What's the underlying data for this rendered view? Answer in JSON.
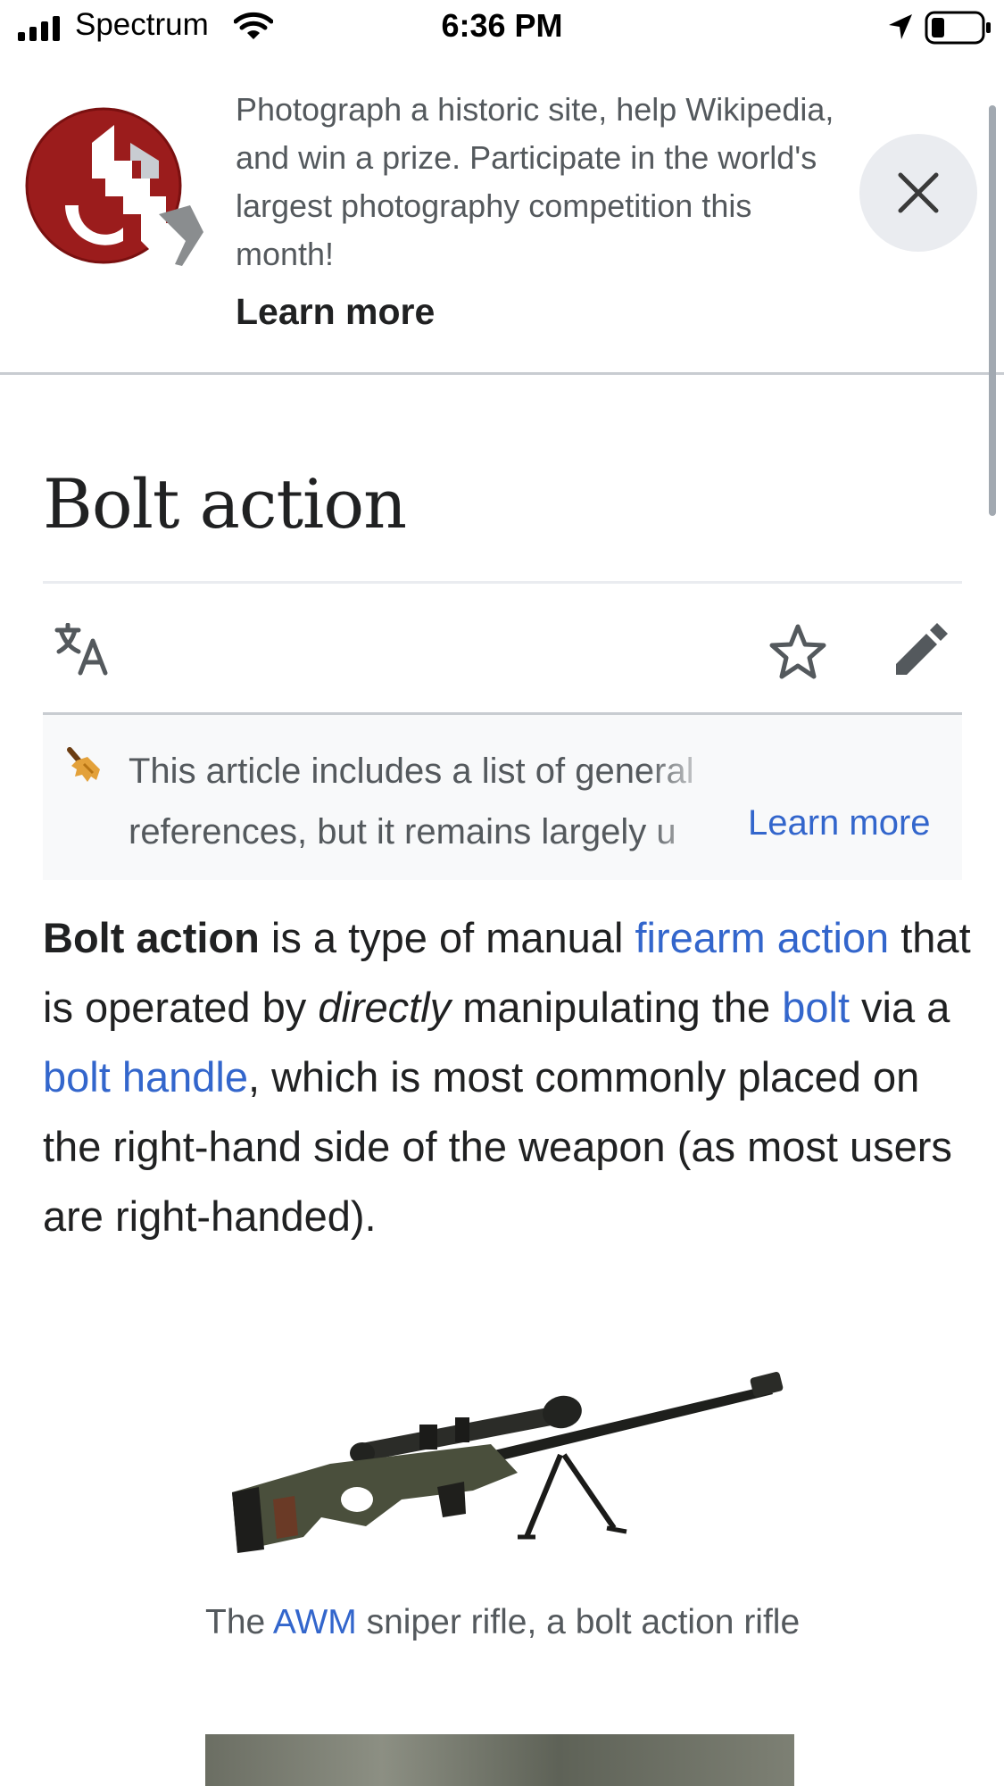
{
  "status_bar": {
    "carrier": "Spectrum",
    "time": "6:36 PM"
  },
  "banner": {
    "text": "Photograph a historic site, help Wikipedia, and win a prize. Participate in the world's largest photography competition this month!",
    "learn_more": "Learn more",
    "logo_icon": "wiki-loves-monuments-logo",
    "close_icon": "close-icon"
  },
  "article": {
    "title": "Bolt action",
    "actions": {
      "language_icon": "translate-icon",
      "watch_icon": "star-icon",
      "edit_icon": "pencil-icon"
    },
    "notice": {
      "text": "This article includes a list of general references, but it remains largely u",
      "learn_more": "Learn more"
    },
    "intro": {
      "bold_term": "Bolt action",
      "t1": " is a type of manual ",
      "link1": "firearm action",
      "t2": " that is operated by ",
      "italic": "directly",
      "t3": " manipulating the ",
      "link2": "bolt",
      "t4": " via a ",
      "link3": "bolt handle",
      "t5": ", which is most commonly placed on the right-hand side of the weapon (as most users are right-handed)."
    },
    "figure": {
      "caption_pre": "The ",
      "caption_link": "AWM",
      "caption_post": " sniper rifle, a bolt action rifle"
    }
  },
  "colors": {
    "link": "#3366cc",
    "text": "#202122",
    "muted": "#54595d",
    "logo_red": "#9b1c1c"
  }
}
